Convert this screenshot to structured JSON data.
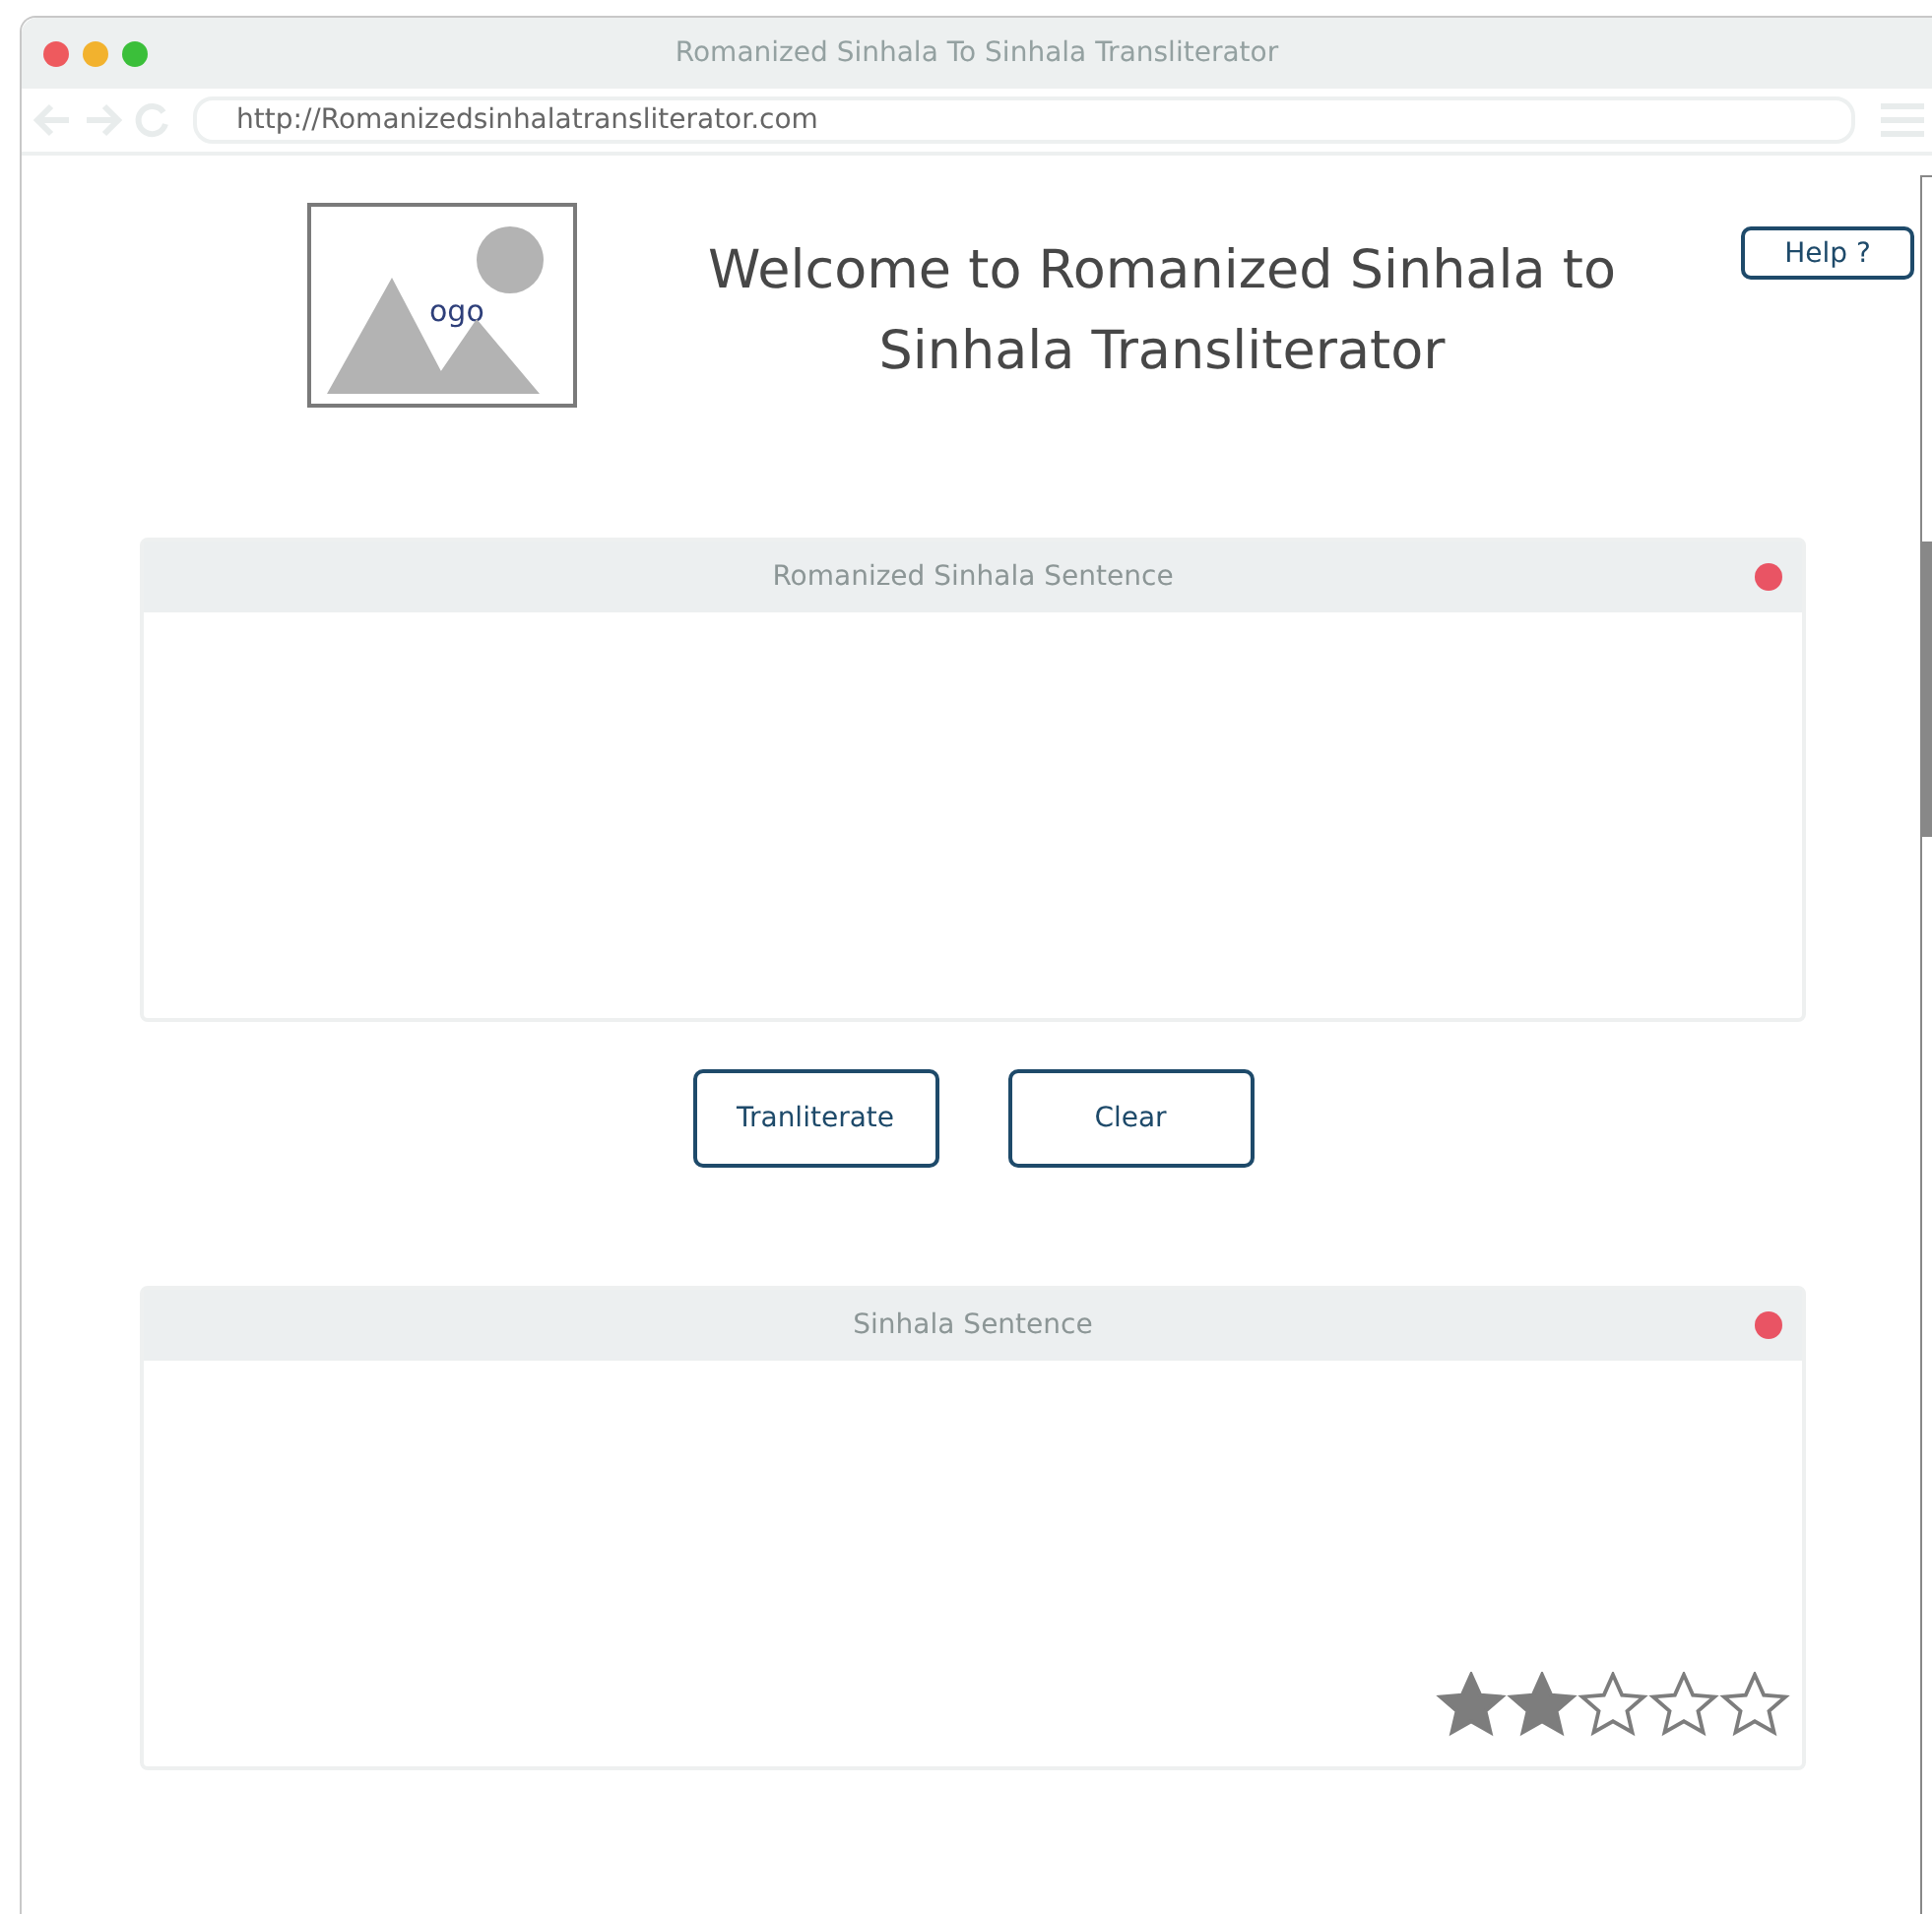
{
  "window": {
    "title": "Romanized Sinhala To Sinhala Transliterator"
  },
  "address_bar": {
    "url": "http://Romanizedsinhalatransliterator.com"
  },
  "logo": {
    "label": "ogo"
  },
  "heading": "Welcome to Romanized Sinhala to Sinhala Transliterator",
  "help_button": "Help ?",
  "input_panel": {
    "title": "Romanized Sinhala Sentence",
    "color": "#e95464"
  },
  "buttons": [
    "Tranliterate",
    "Clear"
  ],
  "output_panel": {
    "title": "Sinhala Sentence",
    "color": "#e95464",
    "stars": 2
  }
}
